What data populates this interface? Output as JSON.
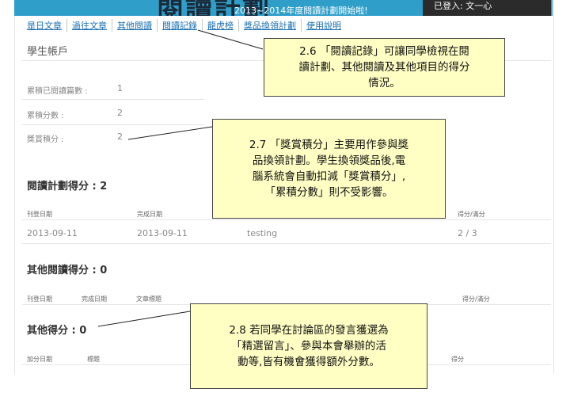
{
  "banner": {
    "title": "閱讀計劃",
    "notice": "2013~2014年度閱讀計劃開始啦!",
    "login": "已登入: 文一心"
  },
  "nav": [
    {
      "label": "是日文章"
    },
    {
      "label": "過往文章"
    },
    {
      "label": "其他閱讀"
    },
    {
      "label": "閱讀記錄"
    },
    {
      "label": "龍虎榜"
    },
    {
      "label": "獎品換領計劃"
    },
    {
      "label": "使用說明"
    }
  ],
  "account": {
    "title": "學生帳戶",
    "stats": [
      {
        "label": "累積已閱讀篇數 :",
        "value": "1"
      },
      {
        "label": "累積分數 :",
        "value": "2"
      },
      {
        "label": "獎賞積分 :",
        "value": "2"
      }
    ]
  },
  "reading_plan": {
    "heading": "閱讀計劃得分 : 2",
    "columns": [
      "刊登日期",
      "完成日期",
      "得分/滿分"
    ],
    "rows": [
      {
        "published": "2013-09-11",
        "completed": "2013-09-11",
        "title": "testing",
        "score": "2 / 3"
      }
    ]
  },
  "other_reading": {
    "heading": "其他閱讀得分 : 0",
    "columns": [
      "刊登日期",
      "完成日期",
      "文章標題",
      "得分/滿分"
    ]
  },
  "other_score": {
    "heading": "其他得分 : 0",
    "columns": [
      "加分日期",
      "標題",
      "得分"
    ]
  },
  "callouts": {
    "c26": [
      "2.6 「閱讀記錄」可讓同學檢視在閱",
      "讀計劃、其他閱讀及其他項目的得分",
      "情況。"
    ],
    "c27": [
      "2.7 「獎賞積分」主要用作參與獎",
      "品換領計劃。學生換領獎品後,電",
      "腦系統會自動扣減「獎賞積分」,",
      "「累積分數」則不受影響。"
    ],
    "c28": [
      "2.8 若同學在討論區的發言獲選為",
      "「精選留言」、參與本會舉辦的活",
      "動等,皆有機會獲得額外分數。"
    ]
  },
  "colors": {
    "nav_link": "#1a6fb0",
    "banner": "#2f9fc9",
    "callout_bg": "#ffffc4"
  }
}
